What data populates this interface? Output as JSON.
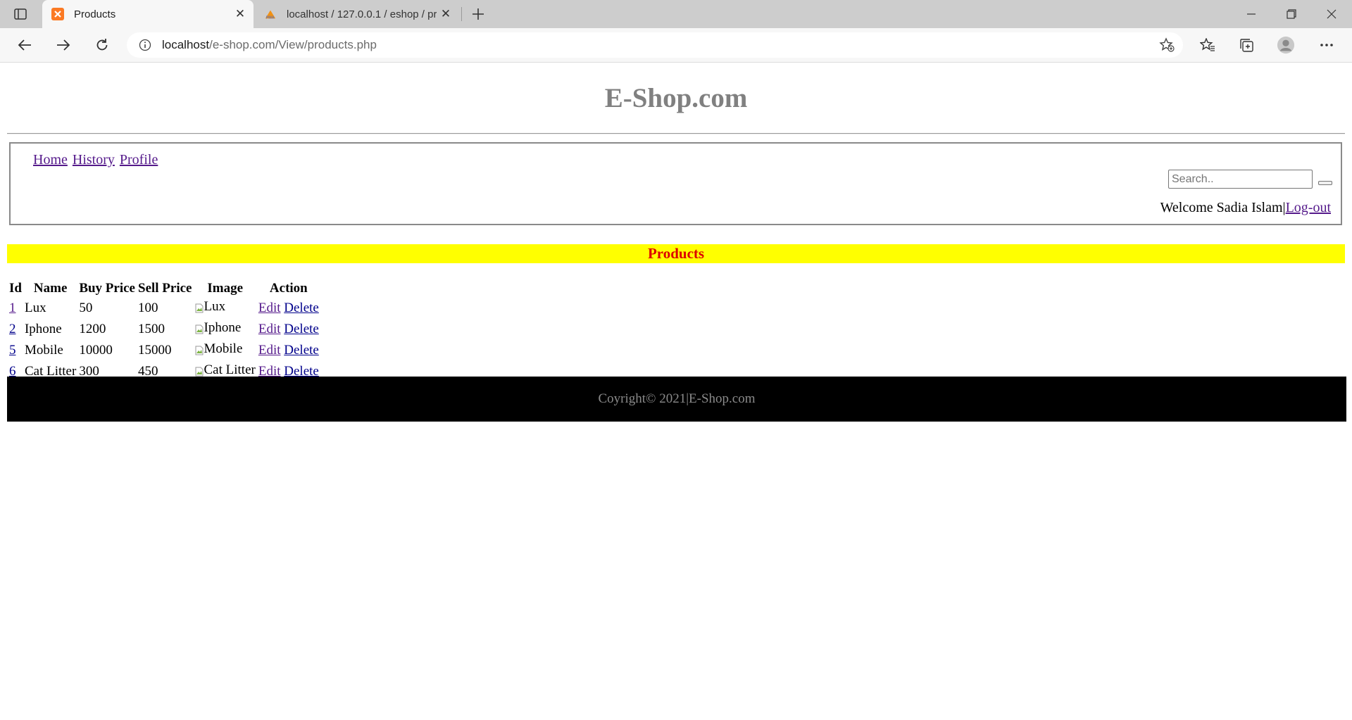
{
  "browser": {
    "tabs": [
      {
        "title": "Products",
        "favicon": "xampp-icon",
        "active": true
      },
      {
        "title": "localhost / 127.0.0.1 / eshop / pr",
        "favicon": "phpmyadmin-icon",
        "active": false
      }
    ],
    "address": {
      "host": "localhost",
      "path": "/e-shop.com/View/products.php"
    }
  },
  "site": {
    "title": "E-Shop.com"
  },
  "nav": {
    "links": [
      "Home",
      "History",
      "Profile"
    ],
    "search_placeholder": "Search..",
    "welcome_text": "Welcome Sadia Islam",
    "separator": "|",
    "logout_label": "Log-out"
  },
  "section": {
    "heading": "Products"
  },
  "table": {
    "headers": [
      "Id",
      "Name",
      "Buy Price",
      "Sell Price",
      "Image",
      "Action"
    ],
    "rows": [
      {
        "id": "1",
        "name": "Lux",
        "buy": "50",
        "sell": "100",
        "image_alt": "Lux",
        "edit": "Edit",
        "delete": "Delete"
      },
      {
        "id": "2",
        "name": "Iphone",
        "buy": "1200",
        "sell": "1500",
        "image_alt": "Iphone",
        "edit": "Edit",
        "delete": "Delete"
      },
      {
        "id": "5",
        "name": "Mobile",
        "buy": "10000",
        "sell": "15000",
        "image_alt": "Mobile",
        "edit": "Edit",
        "delete": "Delete"
      },
      {
        "id": "6",
        "name": "Cat Litter",
        "buy": "300",
        "sell": "450",
        "image_alt": "Cat Litter",
        "edit": "Edit",
        "delete": "Delete"
      }
    ]
  },
  "footer": {
    "text": "Coyright© 2021|E-Shop.com"
  },
  "colors": {
    "title_gray": "#808080",
    "products_bar": "#ffff00",
    "products_text": "#dd0000",
    "footer_bg": "#000000",
    "visited_link": "#551a8b",
    "link": "#00008b"
  }
}
